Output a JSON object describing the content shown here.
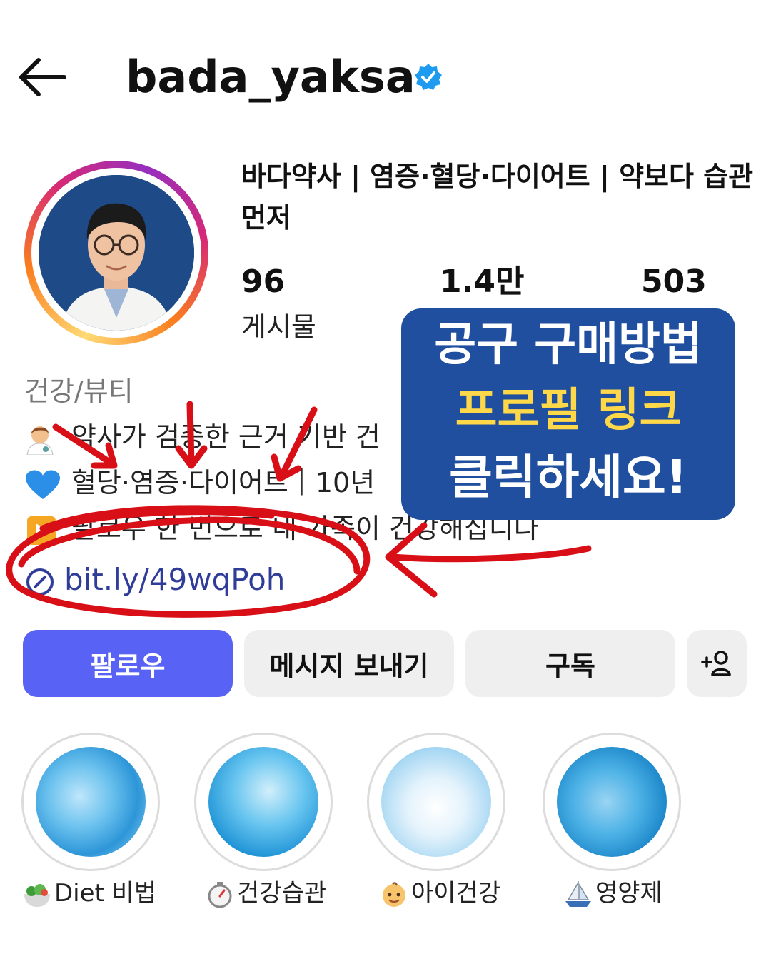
{
  "header": {
    "username": "bada_yaksa",
    "back_icon": "arrow-left-icon",
    "verified_icon": "verified-badge-icon"
  },
  "profile": {
    "full_name": "바다약사 | 염증·혈당·다이어트 | 약보다 습관 먼저",
    "stats": [
      {
        "value": "96",
        "label": "게시물"
      },
      {
        "value": "1.4만",
        "label": ""
      },
      {
        "value": "503",
        "label": ""
      }
    ],
    "category": "건강/뷰티",
    "bio_lines": [
      {
        "icon": "pharmacist-emoji",
        "text": "약사가 검증한 근거 기반 건"
      },
      {
        "icon": "blue-heart-emoji",
        "text": "혈당·염증·다이어트｜10년"
      },
      {
        "icon": "play-button-emoji",
        "text": "팔로우 한 번으로 내 가족이 건강해집니다"
      }
    ],
    "link": "bit.ly/49wqPoh",
    "link_icon": "link-icon"
  },
  "callout": {
    "line1": "공구 구매방법",
    "line2": "프로필 링크",
    "line3": "클릭하세요!",
    "colors": {
      "background": "#1f4f9e",
      "highlight": "#ffd84a",
      "annotation": "#d90f17"
    }
  },
  "actions": {
    "follow": "팔로우",
    "message": "메시지 보내기",
    "subscribe": "구독",
    "add_user": "+♀",
    "accent": "#5862f5"
  },
  "highlights": [
    {
      "label": "Diet 비법",
      "emoji": "salad-emoji"
    },
    {
      "label": "건강습관",
      "emoji": "stopwatch-emoji"
    },
    {
      "label": "아이건강",
      "emoji": "baby-emoji"
    },
    {
      "label": "영양제",
      "emoji": "sailboat-emoji"
    }
  ]
}
